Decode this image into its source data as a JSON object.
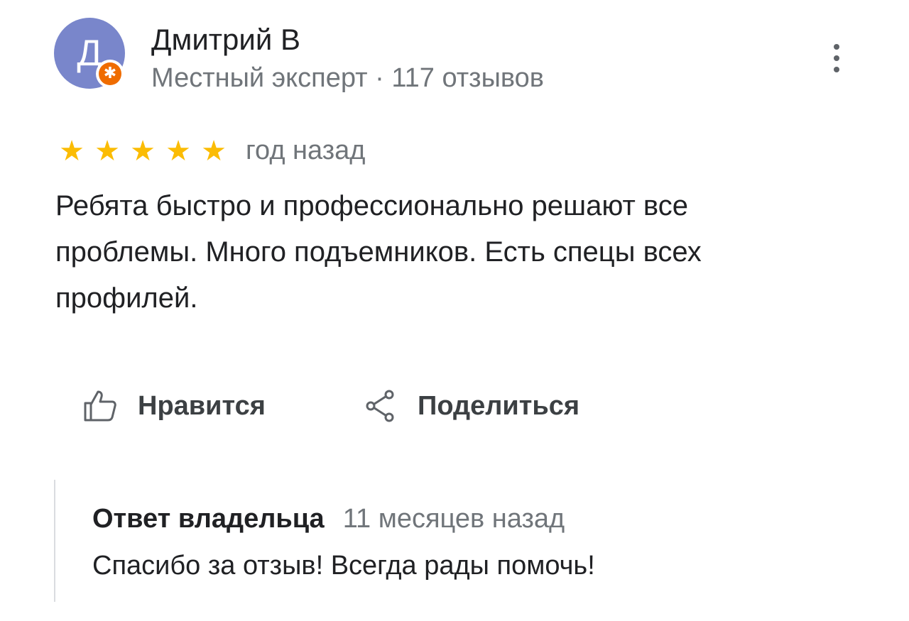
{
  "review": {
    "author": {
      "initial": "Д",
      "name": "Дмитрий В",
      "meta": "Местный эксперт · 117 отзывов",
      "avatar_color": "#7986cb",
      "badge_color": "#ef6c00",
      "badge_icon": "local-guide-star-icon"
    },
    "menu_icon": "more-vert-icon",
    "rating": {
      "stars": 5,
      "max_stars": 5,
      "star_color": "#fbbc04",
      "date": "год назад"
    },
    "text": "Ребята быстро и профессионально решают все проблемы. Много подъемников. Есть спецы всех профилей.",
    "actions": {
      "like_label": "Нравится",
      "like_icon": "thumb-up-icon",
      "share_label": "Поделиться",
      "share_icon": "share-icon"
    },
    "owner_response": {
      "title": "Ответ владельца",
      "date": "11 месяцев назад",
      "text": "Спасибо за отзыв! Всегда рады помочь!"
    }
  }
}
